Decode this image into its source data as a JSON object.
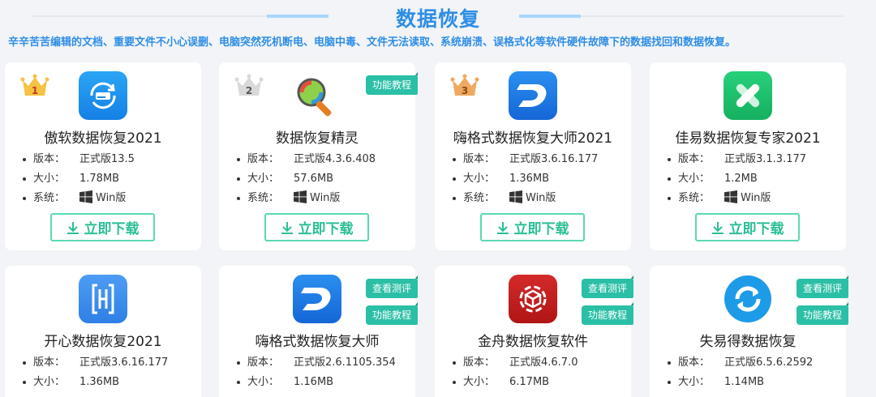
{
  "page": {
    "title": "数据恢复",
    "subtitle": "辛辛苦苦编辑的文档、重要文件不小心误删、电脑突然死机断电、电脑中毒、文件无法读取、系统崩溃、误格式化等软件硬件故障下的数据找回和数据恢复。"
  },
  "labels": {
    "version": "版本：",
    "size": "大小：",
    "system": "系统：",
    "download": "立即下载",
    "review": "查看测评",
    "tutorial": "功能教程"
  },
  "colors": {
    "title": "#2f8ee6",
    "tag": "#2bbfa6",
    "button": "#2bbf96"
  },
  "apps": [
    {
      "name": "傲软数据恢复2021",
      "version": "正式版13.5",
      "size": "1.78MB",
      "system": "Win版",
      "rank": "1",
      "icon": "drive-refresh-icon"
    },
    {
      "name": "数据恢复精灵",
      "version": "正式版4.3.6.408",
      "size": "57.6MB",
      "system": "Win版",
      "rank": "2",
      "tags": [
        "功能教程"
      ],
      "icon": "magnifier-disk-icon"
    },
    {
      "name": "嗨格式数据恢复大师2021",
      "version": "正式版3.6.16.177",
      "size": "1.36MB",
      "system": "Win版",
      "rank": "3",
      "icon": "d-logo-icon"
    },
    {
      "name": "佳易数据恢复专家2021",
      "version": "正式版3.1.3.177",
      "size": "1.2MB",
      "system": "Win版",
      "icon": "cross-bandage-icon"
    },
    {
      "name": "开心数据恢复2021",
      "version": "正式版3.6.16.177",
      "size": "1.36MB",
      "icon": "h-bracket-icon"
    },
    {
      "name": "嗨格式数据恢复大师",
      "version": "正式版2.6.1105.354",
      "size": "1.16MB",
      "tags": [
        "查看测评",
        "功能教程"
      ],
      "icon": "d-logo-icon"
    },
    {
      "name": "金舟数据恢复软件",
      "version": "正式版4.6.7.0",
      "size": "6.17MB",
      "tags": [
        "查看测评",
        "功能教程"
      ],
      "icon": "cube-gear-icon"
    },
    {
      "name": "失易得数据恢复",
      "version": "正式版6.5.6.2592",
      "size": "1.14MB",
      "tags": [
        "查看测评",
        "功能教程"
      ],
      "icon": "circular-arrow-icon"
    }
  ]
}
